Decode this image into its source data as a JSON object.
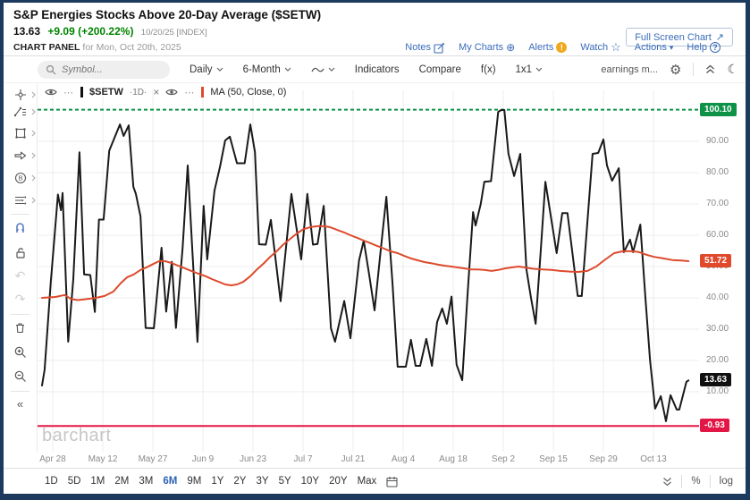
{
  "header": {
    "title": "S&P Energies Stocks Above 20-Day Average ($SETW)",
    "price": "13.63",
    "change": "+9.09 (+200.22%)",
    "date_stamp": "10/20/25 [INDEX]",
    "panel_label": "CHART PANEL",
    "panel_date": " for Mon, Oct 20th, 2025",
    "fullscreen_label": "Full Screen Chart",
    "links": [
      "Notes",
      "My Charts",
      "Alerts",
      "Watch",
      "Actions",
      "Help"
    ]
  },
  "toolbar": {
    "symbol_placeholder": "Symbol...",
    "period_label": "Daily",
    "range_label": "6-Month",
    "indicators_label": "Indicators",
    "compare_label": "Compare",
    "fx_label": "f(x)",
    "grid_label": "1x1",
    "earnings_label": "earnings m..."
  },
  "legend": {
    "symbol": "$SETW",
    "timeframe": "·1D·",
    "ma_label": "MA (50, Close, 0)"
  },
  "icons": {
    "gear": "⚙",
    "moon": "☾",
    "star": "☆",
    "circle_plus": "⊕",
    "caret_down": "▾",
    "undo": "↶",
    "redo": "↷",
    "collapse_left": "«",
    "ellipsis": "⋯",
    "close": "×",
    "fullscreen_arrow": "↗",
    "alert_mark": "!",
    "help_mark": "?"
  },
  "watermark": "barchart",
  "bottom": {
    "ranges": [
      "1D",
      "5D",
      "1M",
      "2M",
      "3M",
      "6M",
      "9M",
      "1Y",
      "2Y",
      "3Y",
      "5Y",
      "10Y",
      "20Y",
      "Max"
    ],
    "active_range": "6M",
    "scale_percent": "%",
    "scale_log": "log"
  },
  "chart_data": {
    "type": "line",
    "title": "S&P Energies Stocks Above 20-Day Average ($SETW)",
    "ylim": [
      -5,
      105
    ],
    "y_ticks": [
      90,
      80,
      70,
      60,
      50,
      40,
      30,
      20,
      10
    ],
    "x_ticks": [
      "Apr 28",
      "May 12",
      "May 27",
      "Jun 9",
      "Jun 23",
      "Jul 7",
      "Jul 21",
      "Aug 4",
      "Aug 18",
      "Sep 2",
      "Sep 15",
      "Sep 29",
      "Oct 13"
    ],
    "sessions": 126,
    "grid": true,
    "hlines": [
      {
        "value": 100.1,
        "style": "dashed",
        "color": "#0e9247"
      },
      {
        "value": -0.93,
        "style": "solid",
        "color": "#e31745"
      }
    ],
    "badges": [
      {
        "value": 100.1,
        "label": "100.10",
        "color": "#0e9247"
      },
      {
        "value": 51.72,
        "label": "51.72",
        "color": "#e0492c"
      },
      {
        "value": 13.63,
        "label": "13.63",
        "color": "#111111"
      },
      {
        "value": -0.93,
        "label": "-0.93",
        "color": "#e31745"
      }
    ],
    "series": [
      {
        "name": "$SETW",
        "color": "#1a1a1a",
        "width": 2,
        "points": [
          [
            0,
            12
          ],
          [
            0.5,
            17
          ],
          [
            1.7,
            45
          ],
          [
            3.1,
            73
          ],
          [
            3.7,
            68
          ],
          [
            4,
            73.5
          ],
          [
            5.1,
            26
          ],
          [
            6.1,
            46
          ],
          [
            7.3,
            86.5
          ],
          [
            8.2,
            47.5
          ],
          [
            9.4,
            47.3
          ],
          [
            10.3,
            35.5
          ],
          [
            11.1,
            65
          ],
          [
            12,
            65
          ],
          [
            13.1,
            87
          ],
          [
            14.1,
            91
          ],
          [
            15.2,
            95.4
          ],
          [
            15.9,
            91.7
          ],
          [
            16.9,
            95.1
          ],
          [
            17.8,
            75.5
          ],
          [
            18.3,
            73.2
          ],
          [
            19.2,
            66
          ],
          [
            20.2,
            30.4
          ],
          [
            21.8,
            30.3
          ],
          [
            23.3,
            56
          ],
          [
            24.2,
            35.6
          ],
          [
            25.3,
            51.5
          ],
          [
            26.1,
            30.4
          ],
          [
            27.4,
            56
          ],
          [
            28.4,
            82.3
          ],
          [
            29.3,
            55
          ],
          [
            30.3,
            25.9
          ],
          [
            31.5,
            69.4
          ],
          [
            32.2,
            52.3
          ],
          [
            33.6,
            74.2
          ],
          [
            34.7,
            82
          ],
          [
            35.7,
            90.3
          ],
          [
            36.6,
            91.5
          ],
          [
            38,
            83
          ],
          [
            39.5,
            83
          ],
          [
            40.6,
            95.4
          ],
          [
            41.5,
            86.6
          ],
          [
            42.3,
            57.1
          ],
          [
            43.6,
            57
          ],
          [
            44.6,
            64.9
          ],
          [
            46.5,
            38.9
          ],
          [
            48.6,
            73.2
          ],
          [
            50.5,
            52.3
          ],
          [
            51.7,
            73.2
          ],
          [
            52.8,
            57
          ],
          [
            53.7,
            57.2
          ],
          [
            54.9,
            69.4
          ],
          [
            56.3,
            30.3
          ],
          [
            57.1,
            26
          ],
          [
            58.9,
            39
          ],
          [
            60.1,
            27.1
          ],
          [
            61.8,
            52
          ],
          [
            62.7,
            58.3
          ],
          [
            63.8,
            47
          ],
          [
            64.8,
            36
          ],
          [
            66,
            55
          ],
          [
            67.1,
            72.3
          ],
          [
            68.3,
            45
          ],
          [
            69.3,
            18
          ],
          [
            70.9,
            18
          ],
          [
            71.9,
            26.6
          ],
          [
            72.8,
            18.3
          ],
          [
            73.7,
            18.3
          ],
          [
            74.9,
            26.9
          ],
          [
            76,
            18.3
          ],
          [
            77,
            32.3
          ],
          [
            78,
            36.6
          ],
          [
            78.9,
            31.7
          ],
          [
            79.8,
            40.4
          ],
          [
            80.8,
            18.6
          ],
          [
            81.9,
            13.7
          ],
          [
            82.9,
            40
          ],
          [
            84,
            67.4
          ],
          [
            84.5,
            63.1
          ],
          [
            85.5,
            70
          ],
          [
            86.2,
            77.1
          ],
          [
            87.5,
            77.3
          ],
          [
            88.9,
            99.4
          ],
          [
            89.5,
            100
          ],
          [
            90.1,
            100
          ],
          [
            90.9,
            86
          ],
          [
            92,
            78.9
          ],
          [
            93.2,
            86
          ],
          [
            94.4,
            49.1
          ],
          [
            95.3,
            40
          ],
          [
            96.2,
            31.7
          ],
          [
            97.2,
            55
          ],
          [
            98.1,
            77.1
          ],
          [
            100.3,
            54.3
          ],
          [
            101.4,
            67.1
          ],
          [
            102.4,
            67.1
          ],
          [
            104.4,
            40.6
          ],
          [
            105.2,
            40.6
          ],
          [
            107.3,
            86
          ],
          [
            108.4,
            86.3
          ],
          [
            109.4,
            90.6
          ],
          [
            110.1,
            82.3
          ],
          [
            111.1,
            77.4
          ],
          [
            112.4,
            81.4
          ],
          [
            113.4,
            54.6
          ],
          [
            114.6,
            58.6
          ],
          [
            115.2,
            54.6
          ],
          [
            116.6,
            63.4
          ],
          [
            117.6,
            40
          ],
          [
            118.5,
            20
          ],
          [
            119.5,
            4.6
          ],
          [
            120.6,
            8.6
          ],
          [
            121.6,
            0.6
          ],
          [
            122.5,
            8.9
          ],
          [
            123.7,
            4.3
          ],
          [
            124.2,
            4.3
          ],
          [
            125.6,
            13.2
          ],
          [
            126,
            13.63
          ]
        ]
      },
      {
        "name": "MA (50, Close, 0)",
        "color": "#dd4a2c",
        "width": 2,
        "points": [
          [
            0,
            40
          ],
          [
            2.6,
            40.3
          ],
          [
            4.4,
            40.9
          ],
          [
            5.7,
            39.6
          ],
          [
            7,
            39.3
          ],
          [
            8.7,
            39.6
          ],
          [
            10.5,
            40
          ],
          [
            12.2,
            40.6
          ],
          [
            13.9,
            42
          ],
          [
            15.3,
            44.6
          ],
          [
            16.6,
            46.6
          ],
          [
            17.8,
            47.4
          ],
          [
            19.2,
            48.9
          ],
          [
            20.6,
            49.9
          ],
          [
            21.8,
            50.9
          ],
          [
            22.8,
            51.7
          ],
          [
            24,
            51.7
          ],
          [
            25.3,
            51.1
          ],
          [
            26.5,
            50.3
          ],
          [
            27.9,
            49.4
          ],
          [
            29.1,
            48.6
          ],
          [
            30.5,
            47.7
          ],
          [
            31.9,
            46.9
          ],
          [
            33.1,
            46
          ],
          [
            34.5,
            45.1
          ],
          [
            35.7,
            44.3
          ],
          [
            36.9,
            44
          ],
          [
            38,
            44.3
          ],
          [
            39.2,
            45.1
          ],
          [
            40.6,
            46.9
          ],
          [
            41.8,
            48.9
          ],
          [
            43.2,
            51
          ],
          [
            44.4,
            53
          ],
          [
            45.8,
            55
          ],
          [
            47,
            57
          ],
          [
            48.4,
            58.9
          ],
          [
            49.7,
            60.6
          ],
          [
            50.9,
            61.9
          ],
          [
            52.3,
            62.6
          ],
          [
            53.7,
            62.9
          ],
          [
            54.9,
            62.9
          ],
          [
            56.1,
            62.6
          ],
          [
            57.5,
            61.7
          ],
          [
            58.9,
            60.9
          ],
          [
            60.1,
            60
          ],
          [
            61.5,
            59.1
          ],
          [
            62.7,
            58.3
          ],
          [
            64.1,
            57.4
          ],
          [
            65.3,
            56.6
          ],
          [
            66.7,
            55.7
          ],
          [
            67.9,
            54.9
          ],
          [
            69.3,
            54.3
          ],
          [
            70.6,
            53.4
          ],
          [
            71.9,
            52.6
          ],
          [
            73.2,
            52
          ],
          [
            74.6,
            51.4
          ],
          [
            75.8,
            51.1
          ],
          [
            77.2,
            50.6
          ],
          [
            78.4,
            50.3
          ],
          [
            79.8,
            50
          ],
          [
            81,
            49.7
          ],
          [
            82.4,
            49.4
          ],
          [
            83.6,
            49.1
          ],
          [
            85,
            49.1
          ],
          [
            86.2,
            48.9
          ],
          [
            87.6,
            48.6
          ],
          [
            88.9,
            48.9
          ],
          [
            90.2,
            49.4
          ],
          [
            91.5,
            49.7
          ],
          [
            92.9,
            50
          ],
          [
            94.1,
            49.7
          ],
          [
            95.8,
            49.3
          ],
          [
            97.6,
            49.1
          ],
          [
            99.3,
            48.9
          ],
          [
            101,
            48.6
          ],
          [
            102.8,
            48.4
          ],
          [
            104.5,
            48.3
          ],
          [
            106.3,
            48.6
          ],
          [
            108,
            50
          ],
          [
            109.8,
            52.3
          ],
          [
            111.5,
            54.3
          ],
          [
            113.2,
            54.9
          ],
          [
            115,
            54.9
          ],
          [
            116.4,
            54.6
          ],
          [
            117.9,
            53.7
          ],
          [
            119.3,
            53.1
          ],
          [
            121.1,
            52.6
          ],
          [
            122.8,
            52.1
          ],
          [
            124.6,
            51.9
          ],
          [
            126,
            51.72
          ]
        ]
      }
    ],
    "last_values": {
      "setw": 13.63,
      "ma": 51.72
    }
  }
}
